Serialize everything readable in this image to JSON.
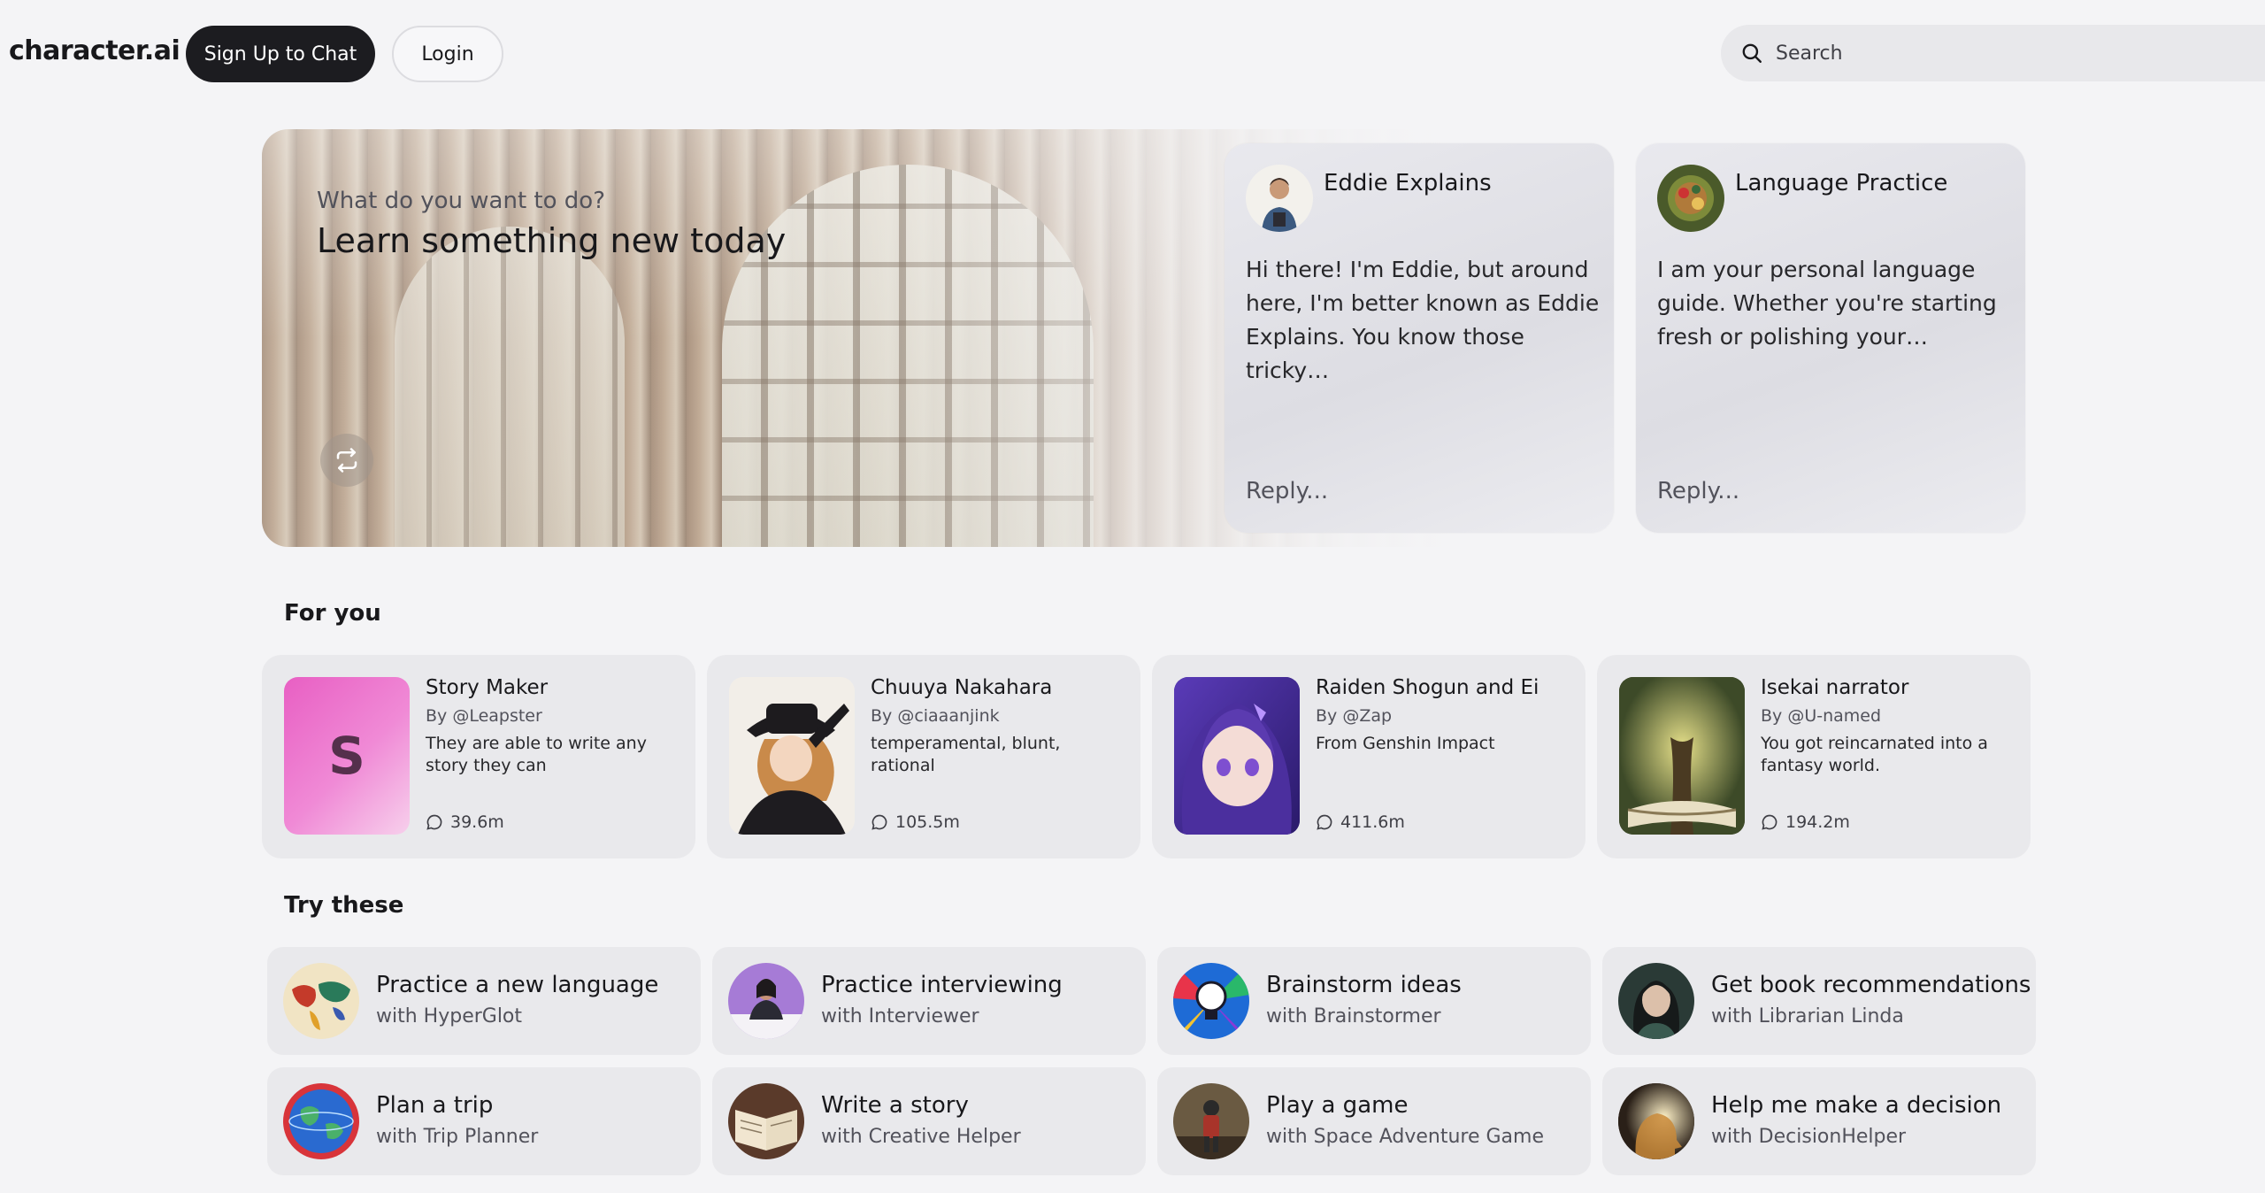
{
  "header": {
    "logo": "character.ai",
    "signup_label": "Sign Up to Chat",
    "login_label": "Login",
    "search_placeholder": "Search"
  },
  "hero": {
    "question": "What do you want to do?",
    "heading": "Learn something new today",
    "cards": [
      {
        "name": "Eddie Explains",
        "message": "Hi there! I'm Eddie, but around here, I'm better known as Eddie Explains. You know those tricky…",
        "reply_placeholder": "Reply..."
      },
      {
        "name": "Language Practice",
        "message": "I am your personal language guide. Whether you're starting fresh or polishing your…",
        "reply_placeholder": "Reply..."
      }
    ]
  },
  "for_you": {
    "title": "For you",
    "items": [
      {
        "name": "Story Maker",
        "by": "By @Leapster",
        "desc": "They are able to write any story they can",
        "count": "39.6m",
        "initial": "S"
      },
      {
        "name": "Chuuya Nakahara",
        "by": "By @ciaaanjink",
        "desc": "temperamental, blunt, rational",
        "count": "105.5m"
      },
      {
        "name": "Raiden Shogun and Ei",
        "by": "By @Zap",
        "desc": "From Genshin Impact",
        "count": "411.6m"
      },
      {
        "name": "Isekai narrator",
        "by": "By @U-named",
        "desc": "You got reincarnated into a fantasy world.",
        "count": "194.2m"
      }
    ]
  },
  "try_these": {
    "title": "Try these",
    "items": [
      {
        "title": "Practice a new language",
        "sub": "with HyperGlot"
      },
      {
        "title": "Practice interviewing",
        "sub": "with Interviewer"
      },
      {
        "title": "Brainstorm ideas",
        "sub": "with Brainstormer"
      },
      {
        "title": "Get book recommendations",
        "sub": "with Librarian Linda"
      },
      {
        "title": "Plan a trip",
        "sub": "with Trip Planner"
      },
      {
        "title": "Write a story",
        "sub": "with Creative Helper"
      },
      {
        "title": "Play a game",
        "sub": "with Space Adventure Game"
      },
      {
        "title": "Help me make a decision",
        "sub": "with DecisionHelper"
      }
    ]
  },
  "colors": {
    "primary_button": "#1c1c20",
    "card_bg": "#e9e9ec",
    "page_bg": "#f4f4f6"
  }
}
